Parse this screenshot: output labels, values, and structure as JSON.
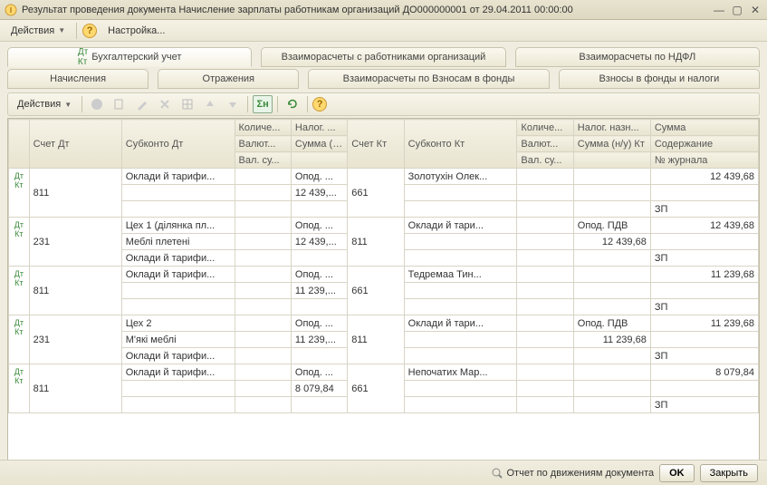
{
  "window": {
    "title": "Результат проведения документа Начисление зарплаты работникам организаций ДО000000001 от 29.04.2011 00:00:00"
  },
  "menubar": {
    "actions": "Действия",
    "settings": "Настройка..."
  },
  "tabs_row1": {
    "t1": "Бухгалтерский учет",
    "t2": "Взаиморасчеты с работниками организаций",
    "t3": "Взаиморасчеты по НДФЛ"
  },
  "tabs_row2": {
    "t1": "Начисления",
    "t2": "Отражения",
    "t3": "Взаиморасчеты по Взносам в фонды",
    "t4": "Взносы в фонды и налоги"
  },
  "toolbar": {
    "actions": "Действия"
  },
  "headers": {
    "r1": {
      "c2": "Счет Дт",
      "c3": "Субконто Дт",
      "c4": "Количе...",
      "c5": "Налог. ...",
      "c6": "Счет Кт",
      "c7": "Субконто Кт",
      "c8": "Количе...",
      "c9": "Налог. назн...",
      "c10": "Сумма"
    },
    "r2": {
      "c4": "Валют...",
      "c5": "Сумма (н/у) Дт",
      "c8": "Валют...",
      "c9": "Сумма (н/у) Кт",
      "c10": "Содержание"
    },
    "r3": {
      "c4": "Вал. су...",
      "c8": "Вал. су...",
      "c10": "№ журнала"
    }
  },
  "rows": [
    {
      "acct_dt": "811",
      "sub_dt1": "Оклади й тарифи...",
      "tax_dt": "Опод. ...",
      "sum_dt": "12 439,...",
      "acct_kt": "661",
      "sub_kt1": "Золотухін Олек...",
      "sum": "12 439,68",
      "desc": "ЗП"
    },
    {
      "acct_dt": "231",
      "sub_dt1": "Цех 1 (ділянка пл...",
      "sub_dt2": "Меблі плетені",
      "sub_dt3": "Оклади й тарифи...",
      "tax_dt": "Опод. ...",
      "sum_dt": "12 439,...",
      "acct_kt": "811",
      "sub_kt1": "Оклади й тари...",
      "tax_kt": "Опод. ПДВ",
      "sum_kt": "12 439,68",
      "sum": "12 439,68",
      "desc": "ЗП"
    },
    {
      "acct_dt": "811",
      "sub_dt1": "Оклади й тарифи...",
      "tax_dt": "Опод. ...",
      "sum_dt": "11 239,...",
      "acct_kt": "661",
      "sub_kt1": "Тедремаа Тин...",
      "sum": "11 239,68",
      "desc": "ЗП"
    },
    {
      "acct_dt": "231",
      "sub_dt1": "Цех 2",
      "sub_dt2": "М'які меблі",
      "sub_dt3": "Оклади й тарифи...",
      "tax_dt": "Опод. ...",
      "sum_dt": "11 239,...",
      "acct_kt": "811",
      "sub_kt1": "Оклади й тари...",
      "tax_kt": "Опод. ПДВ",
      "sum_kt": "11 239,68",
      "sum": "11 239,68",
      "desc": "ЗП"
    },
    {
      "acct_dt": "811",
      "sub_dt1": "Оклади й тарифи...",
      "tax_dt": "Опод. ...",
      "sum_dt": "8 079,84",
      "acct_kt": "661",
      "sub_kt1": "Непочатих Мар...",
      "sum": "8 079,84",
      "desc": "ЗП"
    }
  ],
  "footer": {
    "report": "Отчет по движениям документа",
    "ok": "OK",
    "close": "Закрыть"
  }
}
